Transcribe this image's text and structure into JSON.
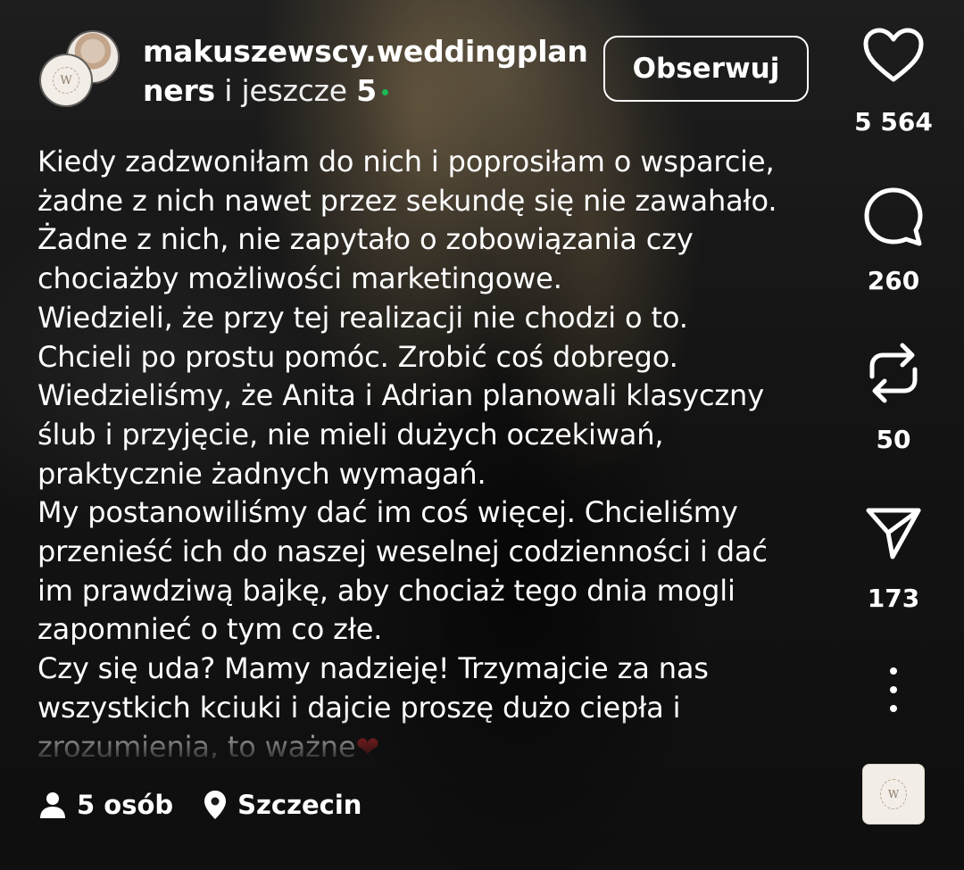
{
  "header": {
    "author_name_line1": "makuszewscy.weddingplan",
    "author_name_line2": "ners",
    "collab_prefix": "i jeszcze",
    "collab_count": "5",
    "follow_label": "Obserwuj"
  },
  "caption": {
    "lines": [
      "Kiedy zadzwoniłam do nich i poprosiłam o wsparcie,",
      "żadne z nich nawet przez sekundę się nie zawahało.",
      "Żadne z nich, nie zapytało o zobowiązania czy",
      "chociażby możliwości marketingowe.",
      "Wiedzieli, że przy tej realizacji nie chodzi o to.",
      "Chcieli po prostu pomóc. Zrobić coś dobrego.",
      "Wiedzieliśmy, że Anita i Adrian planowali klasyczny",
      "ślub i przyjęcie, nie mieli dużych oczekiwań,",
      "praktycznie żadnych wymagań.",
      "My postanowiliśmy dać im coś więcej. Chcieliśmy",
      "przenieść ich do naszej weselnej codzienności i dać",
      "im prawdziwą bajkę, aby chociaż tego dnia mogli",
      "zapomnieć o tym co złe.",
      "Czy się uda? Mamy nadzieję! Trzymajcie za nas",
      "wszystkich kciuki i dajcie proszę dużo ciepła i"
    ],
    "last_line_text": "zrozumienia, to ważne",
    "last_line_emoji": "❤"
  },
  "actions": {
    "like": {
      "icon": "heart-icon",
      "count": "5 564"
    },
    "comment": {
      "icon": "comment-bubble-icon",
      "count": "260"
    },
    "repost": {
      "icon": "repost-icon",
      "count": "50"
    },
    "share": {
      "icon": "send-icon",
      "count": "173"
    },
    "more": {
      "icon": "more-vertical-icon"
    }
  },
  "footer": {
    "people_label": "5 osób",
    "location_label": "Szczecin"
  },
  "colors": {
    "text": "#ffffff",
    "online_dot": "#1db954",
    "heart_emoji": "#c0262c"
  }
}
